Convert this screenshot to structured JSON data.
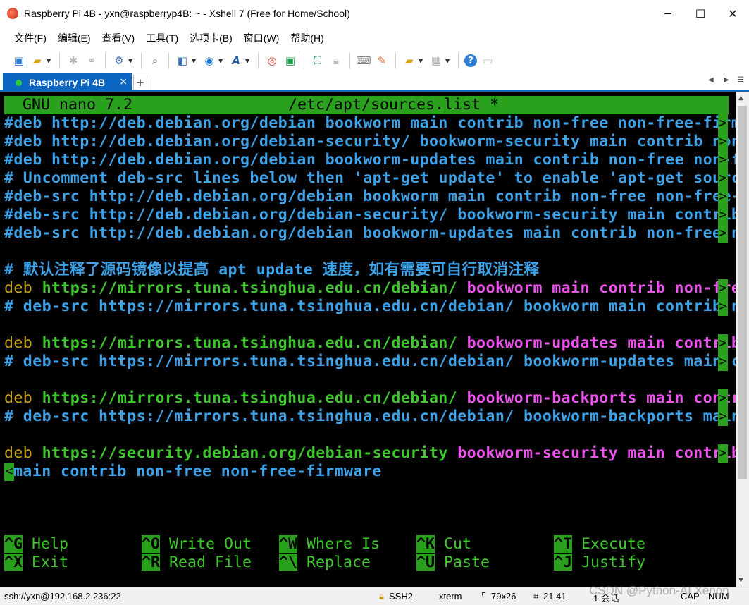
{
  "window": {
    "title": "Raspberry Pi 4B - yxn@raspberryp4B: ~ - Xshell 7 (Free for Home/School)",
    "minimize": "─",
    "maximize": "☐",
    "close": "✕"
  },
  "menu": [
    "文件(F)",
    "编辑(E)",
    "查看(V)",
    "工具(T)",
    "选项卡(B)",
    "窗口(W)",
    "帮助(H)"
  ],
  "tab": {
    "label": "Raspberry Pi 4B",
    "close": "×",
    "add": "+"
  },
  "nano": {
    "header_left": "  GNU nano 7.2",
    "header_center": "/etc/apt/sources.list *",
    "lines": [
      [
        {
          "t": "#deb http://deb.debian.org/debian bookworm main contrib non-free non-free-firm",
          "c": "blue"
        }
      ],
      [
        {
          "t": "#deb http://deb.debian.org/debian-security/ bookworm-security main contrib non",
          "c": "blue"
        }
      ],
      [
        {
          "t": "#deb http://deb.debian.org/debian bookworm-updates main contrib non-free non-f",
          "c": "blue"
        }
      ],
      [
        {
          "t": "# Uncomment deb-src lines below then 'apt-get update' to enable 'apt-get sourc",
          "c": "blue"
        }
      ],
      [
        {
          "t": "#deb-src http://deb.debian.org/debian bookworm main contrib non-free non-free-",
          "c": "blue"
        }
      ],
      [
        {
          "t": "#deb-src http://deb.debian.org/debian-security/ bookworm-security main contrib",
          "c": "blue"
        }
      ],
      [
        {
          "t": "#deb-src http://deb.debian.org/debian bookworm-updates main contrib non-free n",
          "c": "blue"
        }
      ],
      [],
      [
        {
          "t": "# 默认注释了源码镜像以提高 apt update 速度，如有需要可自行取消注释",
          "c": "blue"
        }
      ],
      [
        {
          "t": "deb ",
          "c": "yellow"
        },
        {
          "t": "https://mirrors.tuna.tsinghua.edu.cn/debian/ ",
          "c": "green"
        },
        {
          "t": "bookworm main contrib non-fre",
          "c": "mag"
        }
      ],
      [
        {
          "t": "# deb-src https://mirrors.tuna.tsinghua.edu.cn/debian/ bookworm main contrib n",
          "c": "blue"
        }
      ],
      [],
      [
        {
          "t": "deb ",
          "c": "yellow"
        },
        {
          "t": "https://mirrors.tuna.tsinghua.edu.cn/debian/ ",
          "c": "green"
        },
        {
          "t": "bookworm-updates main contrib",
          "c": "mag"
        }
      ],
      [
        {
          "t": "# deb-src https://mirrors.tuna.tsinghua.edu.cn/debian/ bookworm-updates main c",
          "c": "blue"
        }
      ],
      [],
      [
        {
          "t": "deb ",
          "c": "yellow"
        },
        {
          "t": "https://mirrors.tuna.tsinghua.edu.cn/debian/ ",
          "c": "green"
        },
        {
          "t": "bookworm-backports main contr",
          "c": "mag"
        }
      ],
      [
        {
          "t": "# deb-src https://mirrors.tuna.tsinghua.edu.cn/debian/ bookworm-backports main",
          "c": "blue"
        }
      ],
      [],
      [
        {
          "t": "deb ",
          "c": "yellow"
        },
        {
          "t": "https://security.debian.org/debian-security ",
          "c": "green"
        },
        {
          "t": "bookworm-security main contrib",
          "c": "mag"
        }
      ],
      [
        {
          "t": "main contrib non-free non-free-firmware",
          "c": "blue"
        }
      ]
    ],
    "overflow_marker": ">",
    "continuation_marker": "<",
    "shortcuts": [
      [
        {
          "k": "^G",
          "l": " Help"
        },
        {
          "k": "^O",
          "l": " Write Out"
        },
        {
          "k": "^W",
          "l": " Where Is"
        },
        {
          "k": "^K",
          "l": " Cut"
        },
        {
          "k": "^T",
          "l": " Execute"
        }
      ],
      [
        {
          "k": "^X",
          "l": " Exit"
        },
        {
          "k": "^R",
          "l": " Read File"
        },
        {
          "k": "^\\",
          "l": " Replace"
        },
        {
          "k": "^U",
          "l": " Paste"
        },
        {
          "k": "^J",
          "l": " Justify"
        }
      ]
    ]
  },
  "status": {
    "host": "ssh://yxn@192.168.2.236:22",
    "protocol": "SSH2",
    "term": "xterm",
    "size": "79x26",
    "cursor": "21,41",
    "sessions": "1 会话",
    "caps": "CAP",
    "num": "NUM"
  },
  "watermark": "CSDN @Python-AI Xenon",
  "colors": {
    "blue": "#3da2e8",
    "yellow": "#c8a400",
    "green": "#3ec82c",
    "magenta": "#f052f0",
    "nano_bar": "#2aa11c",
    "tab": "#0b66c2"
  }
}
